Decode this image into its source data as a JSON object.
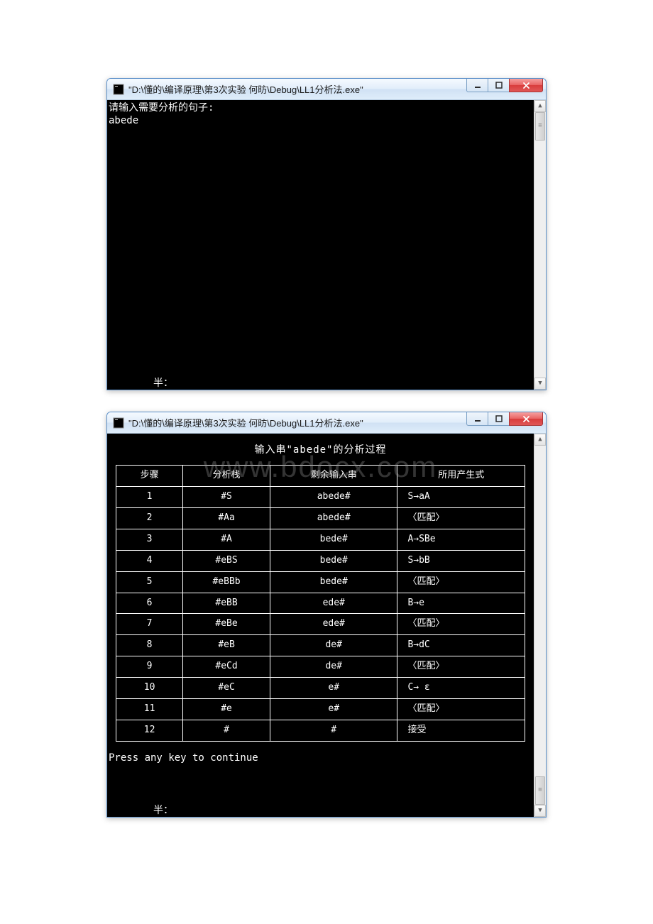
{
  "window1": {
    "title": "\"D:\\懂的\\编译原理\\第3次实验 何昉\\Debug\\LL1分析法.exe\"",
    "prompt": "请输入需要分析的句子:",
    "input": "abede",
    "bottom_char": "半："
  },
  "window2": {
    "title": "\"D:\\懂的\\编译原理\\第3次实验 何昉\\Debug\\LL1分析法.exe\"",
    "analysis_title": "输入串\"abede\"的分析过程",
    "watermark": "www.bdocx.com",
    "headers": [
      "步骤",
      "分析栈",
      "剩余输入串",
      "所用产生式"
    ],
    "rows": [
      {
        "step": "1",
        "stack": "#S",
        "remain": "abede#",
        "prod": "S→aA"
      },
      {
        "step": "2",
        "stack": "#Aa",
        "remain": "abede#",
        "prod": "〈匹配〉"
      },
      {
        "step": "3",
        "stack": "#A",
        "remain": "bede#",
        "prod": "A→SBe"
      },
      {
        "step": "4",
        "stack": "#eBS",
        "remain": "bede#",
        "prod": "S→bB"
      },
      {
        "step": "5",
        "stack": "#eBBb",
        "remain": "bede#",
        "prod": "〈匹配〉"
      },
      {
        "step": "6",
        "stack": "#eBB",
        "remain": "ede#",
        "prod": "B→e"
      },
      {
        "step": "7",
        "stack": "#eBe",
        "remain": "ede#",
        "prod": "〈匹配〉"
      },
      {
        "step": "8",
        "stack": "#eB",
        "remain": "de#",
        "prod": "B→dC"
      },
      {
        "step": "9",
        "stack": "#eCd",
        "remain": "de#",
        "prod": "〈匹配〉"
      },
      {
        "step": "10",
        "stack": "#eC",
        "remain": "e#",
        "prod": "C→ ε"
      },
      {
        "step": "11",
        "stack": "#e",
        "remain": "e#",
        "prod": "〈匹配〉"
      },
      {
        "step": "12",
        "stack": "#",
        "remain": "#",
        "prod": "接受"
      }
    ],
    "press_key": "Press any key to continue",
    "bottom_char": "半："
  },
  "buttons": {
    "minimize": "minimize",
    "maximize": "maximize",
    "close": "close"
  },
  "scrollbar": {
    "up": "▲",
    "down": "▼"
  }
}
